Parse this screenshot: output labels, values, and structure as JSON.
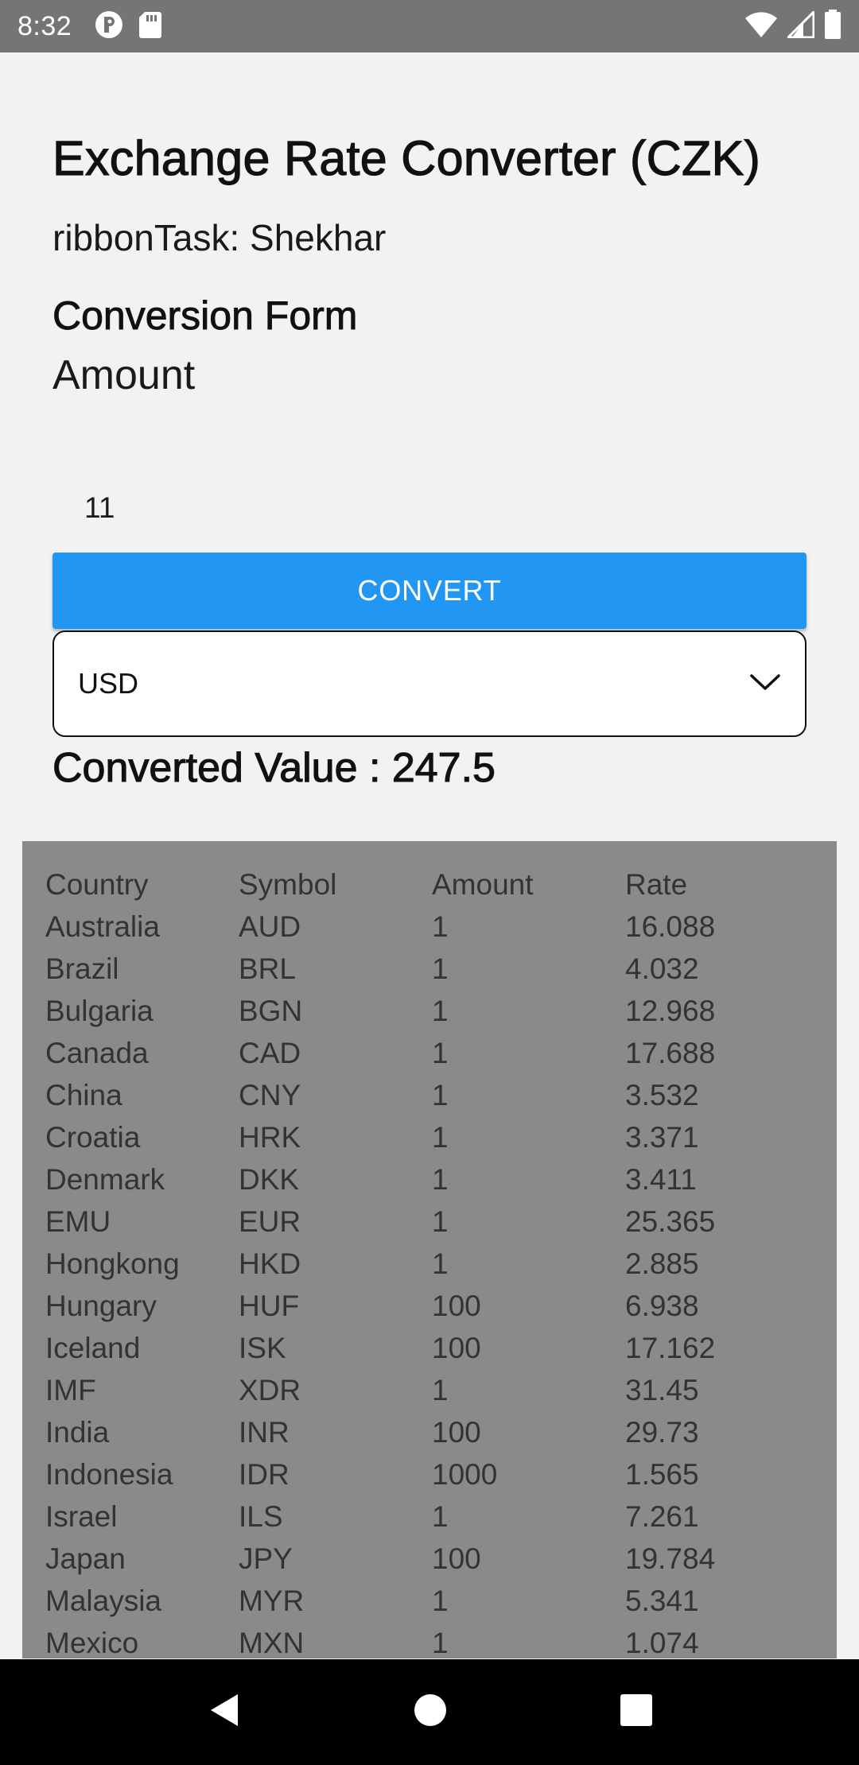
{
  "status_bar": {
    "time": "8:32"
  },
  "app": {
    "title": "Exchange Rate Converter (CZK)",
    "subtitle": "ribbonTask: Shekhar"
  },
  "form": {
    "heading": "Conversion Form",
    "amount_label": "Amount",
    "amount_value": "11",
    "convert_label": "CONVERT",
    "currency_selected": "USD",
    "converted_value": "Converted Value : 247.5"
  },
  "table": {
    "headers": [
      "Country",
      "Symbol",
      "Amount",
      "Rate"
    ],
    "rows": [
      [
        "Australia",
        "AUD",
        "1",
        "16.088"
      ],
      [
        "Brazil",
        "BRL",
        "1",
        "4.032"
      ],
      [
        "Bulgaria",
        "BGN",
        "1",
        "12.968"
      ],
      [
        "Canada",
        "CAD",
        "1",
        "17.688"
      ],
      [
        "China",
        "CNY",
        "1",
        "3.532"
      ],
      [
        "Croatia",
        "HRK",
        "1",
        "3.371"
      ],
      [
        "Denmark",
        "DKK",
        "1",
        "3.411"
      ],
      [
        "EMU",
        "EUR",
        "1",
        "25.365"
      ],
      [
        "Hongkong",
        "HKD",
        "1",
        "2.885"
      ],
      [
        "Hungary",
        "HUF",
        "100",
        "6.938"
      ],
      [
        "Iceland",
        "ISK",
        "100",
        "17.162"
      ],
      [
        "IMF",
        "XDR",
        "1",
        "31.45"
      ],
      [
        "India",
        "INR",
        "100",
        "29.73"
      ],
      [
        "Indonesia",
        "IDR",
        "1000",
        "1.565"
      ],
      [
        "Israel",
        "ILS",
        "1",
        "7.261"
      ],
      [
        "Japan",
        "JPY",
        "100",
        "19.784"
      ],
      [
        "Malaysia",
        "MYR",
        "1",
        "5.341"
      ],
      [
        "Mexico",
        "MXN",
        "1",
        "1.074"
      ]
    ]
  },
  "colors": {
    "status_bar": "#757575",
    "button": "#2196f3",
    "table_bg": "#8a8a8a",
    "page_bg": "#f2f2f2"
  },
  "icons": {
    "status_left": [
      "app-notification-icon",
      "sd-card-icon"
    ],
    "status_right": [
      "wifi-icon",
      "cell-signal-icon",
      "battery-icon"
    ],
    "dropdown": "chevron-down-icon",
    "nav": [
      "back-icon",
      "home-icon",
      "recents-icon"
    ]
  }
}
